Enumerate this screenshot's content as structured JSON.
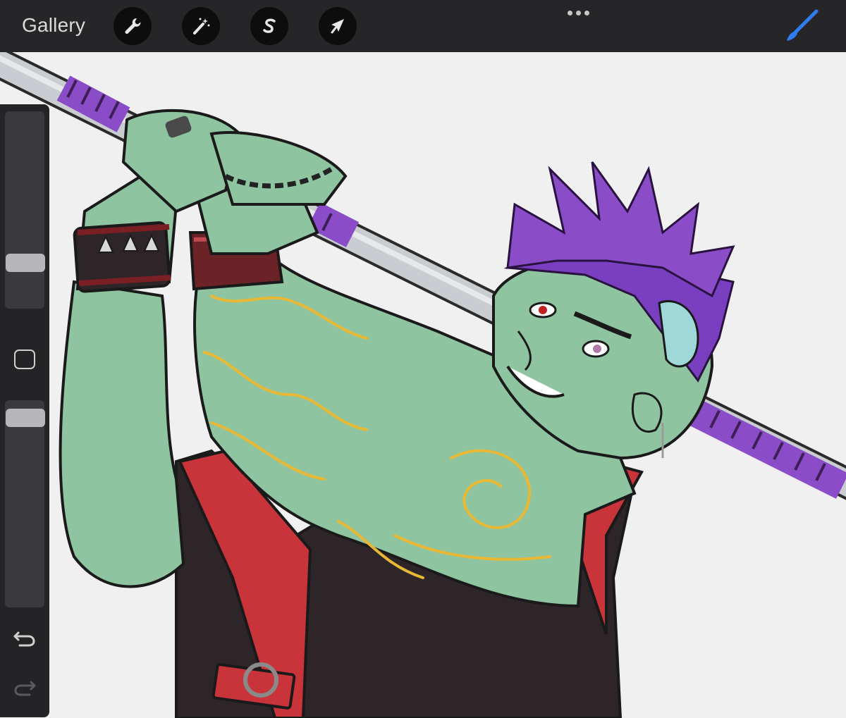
{
  "topbar": {
    "gallery_label": "Gallery",
    "tools": [
      {
        "name": "actions",
        "icon": "wrench-icon"
      },
      {
        "name": "adjustments",
        "icon": "magic-wand-icon"
      },
      {
        "name": "selection",
        "icon": "selection-s-icon"
      },
      {
        "name": "transform",
        "icon": "arrow-cursor-icon"
      }
    ],
    "more_icon": "ellipsis-icon",
    "brush_icon": "brush-icon",
    "brush_color": "#2f7bf0"
  },
  "sidebar": {
    "brush_size_level": 0.28,
    "opacity_level": 0.9,
    "modify_icon": "square-icon",
    "undo_icon": "undo-icon",
    "redo_icon": "redo-icon"
  },
  "artwork": {
    "background": "#f0f0f1",
    "skin_color": "#8fc4a0",
    "hair_color": "#7a3fc0",
    "vest_color": "#2e2529",
    "collar_color": "#c9343a",
    "tattoo_color": "#e8b835"
  }
}
